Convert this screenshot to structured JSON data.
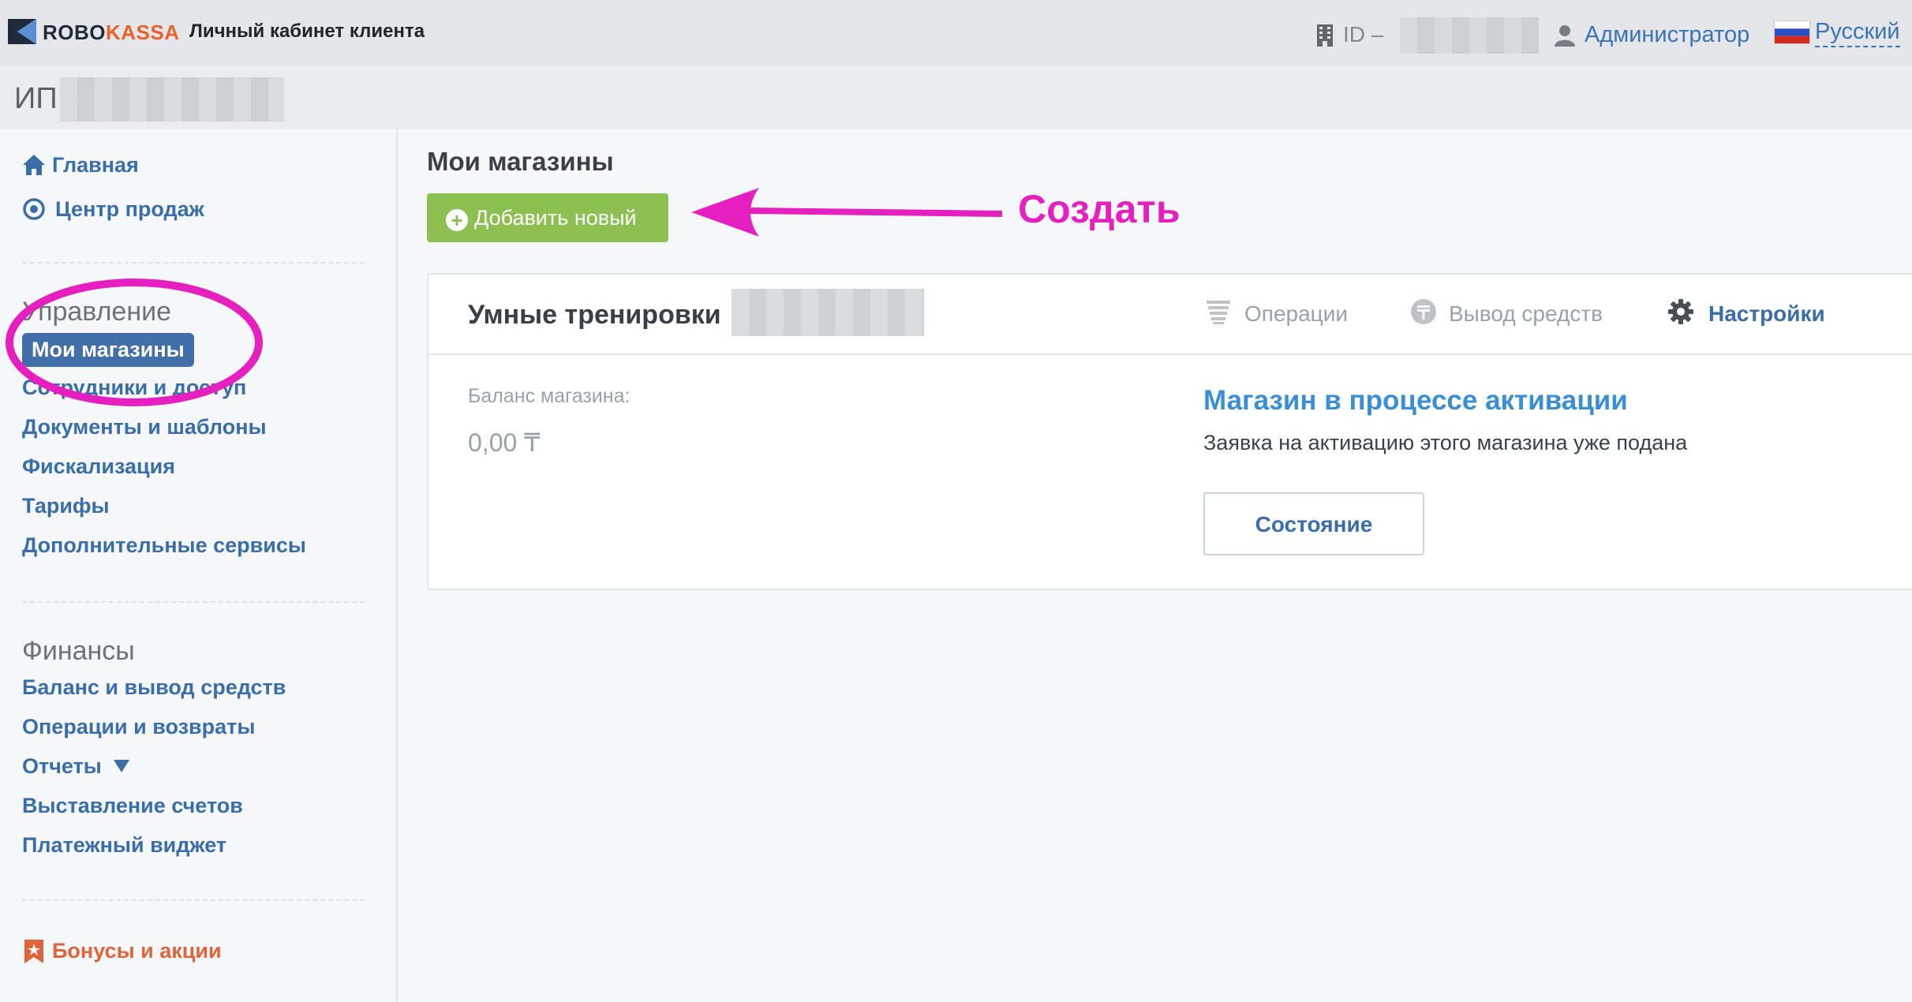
{
  "header": {
    "brand_part1": "ROBO",
    "brand_part2": "KASSA",
    "subtitle": "Личный кабинет клиента",
    "id_label": "ID –",
    "user_role": "Администратор",
    "language": "Русский"
  },
  "org": {
    "prefix": "ИП"
  },
  "sidebar": {
    "top_items": [
      {
        "label": "Главная",
        "icon": "home-icon"
      },
      {
        "label": "Центр продаж",
        "icon": "target-icon"
      }
    ],
    "management": {
      "title": "Управление",
      "items": [
        "Мои магазины",
        "Сотрудники и доступ",
        "Документы и шаблоны",
        "Фискализация",
        "Тарифы",
        "Дополнительные сервисы"
      ],
      "active_index": 0
    },
    "finance": {
      "title": "Финансы",
      "items": [
        "Баланс и вывод средств",
        "Операции и возвраты",
        "Отчеты",
        "Выставление счетов",
        "Платежный виджет"
      ]
    },
    "bonus": {
      "label": "Бонусы и акции",
      "icon": "bookmark-star-icon"
    }
  },
  "main": {
    "title": "Мои магазины",
    "add_button": "Добавить новый",
    "annotation": "Создать"
  },
  "shop_card": {
    "name": "Умные тренировки",
    "tabs": [
      {
        "label": "Операции",
        "icon": "stack-icon",
        "active": false
      },
      {
        "label": "Вывод средств",
        "icon": "tenge-coin-icon",
        "active": false
      },
      {
        "label": "Настройки",
        "icon": "gear-icon",
        "active": true
      }
    ],
    "balance_label": "Баланс магазина:",
    "balance_value": "0,00 ₸",
    "status_title": "Магазин в процессе активации",
    "status_desc": "Заявка на активацию этого магазина уже подана",
    "state_button": "Состояние"
  },
  "colors": {
    "accent_link": "#3a6ea8",
    "add_button": "#8cc152",
    "annotation": "#e51fc0",
    "status_title": "#3a8fd4",
    "bonus": "#e0643a"
  }
}
